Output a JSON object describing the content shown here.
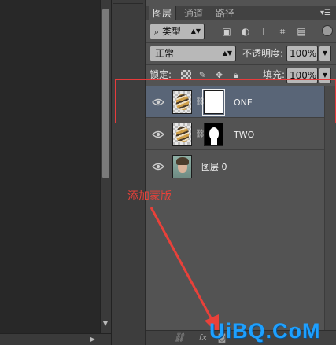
{
  "tabs": [
    {
      "label": "图层",
      "active": true
    },
    {
      "label": "通道",
      "active": false
    },
    {
      "label": "路径",
      "active": false
    }
  ],
  "filter": {
    "kind_label": "类型",
    "kind_icon": "⌕"
  },
  "blend": {
    "mode": "正常",
    "opacity_label": "不透明度:",
    "opacity_value": "100%"
  },
  "lock": {
    "label": "锁定:",
    "fill_label": "填充:",
    "fill_value": "100%"
  },
  "layers": [
    {
      "name": "ONE",
      "selected": true,
      "mask": "white"
    },
    {
      "name": "TWO",
      "selected": false,
      "mask": "black-silhouette"
    },
    {
      "name": "图层 0",
      "selected": false,
      "mask": "none"
    }
  ],
  "annotation": {
    "text": "添加蒙版",
    "color": "#e8413a"
  },
  "bottom": {
    "fx_label": "fx"
  },
  "watermark": {
    "text": "UiBQ.CoM",
    "color": "#1ea0ff"
  },
  "colors": {
    "panel": "#535353",
    "selected_row": "#596577",
    "annotation": "#e63b3b"
  }
}
